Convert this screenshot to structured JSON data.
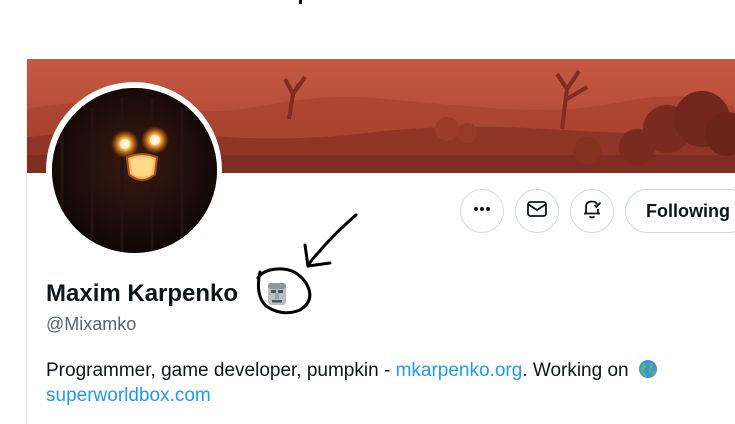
{
  "profile": {
    "display_name": "Maxim Karpenko",
    "name_emoji": "moai-emoji",
    "handle": "@Mixamko",
    "bio": {
      "text_before_link": "Programmer, game developer, pumpkin - ",
      "link1": "mkarpenko.org",
      "text_middle": ". Working on ",
      "emoji": "globe-emoji",
      "link2": "superworldbox.com"
    }
  },
  "actions": {
    "more_icon": "more-icon",
    "message_icon": "mail-icon",
    "notify_icon": "bell-icon",
    "follow_label": "Following"
  },
  "colors": {
    "link": "#1d9bf0",
    "text": "#0f1419",
    "secondary": "#536471",
    "banner": "#b8503a"
  }
}
